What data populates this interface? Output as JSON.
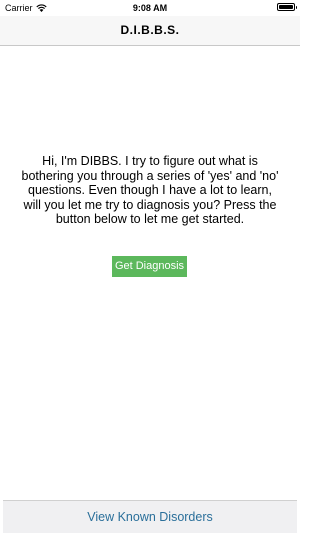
{
  "status_bar": {
    "carrier": "Carrier",
    "time": "9:08 AM",
    "wifi_icon": "wifi-icon",
    "battery_icon": "battery-icon"
  },
  "nav": {
    "title": "D.I.B.B.S."
  },
  "main": {
    "intro_text": "Hi, I'm DIBBS. I try to figure out what is bothering you through a series of 'yes' and 'no' questions.  Even though I have a lot to learn, will you let me try to diagnosis you? Press the button below to let me get started.",
    "diagnosis_button_label": "Get Diagnosis"
  },
  "bottom": {
    "disorders_button_label": "View Known Disorders"
  },
  "colors": {
    "accent_green": "#5cb85c",
    "link_blue": "#2a6f9a",
    "nav_background": "#f7f7f7",
    "bottom_background": "#f0f0f2"
  }
}
